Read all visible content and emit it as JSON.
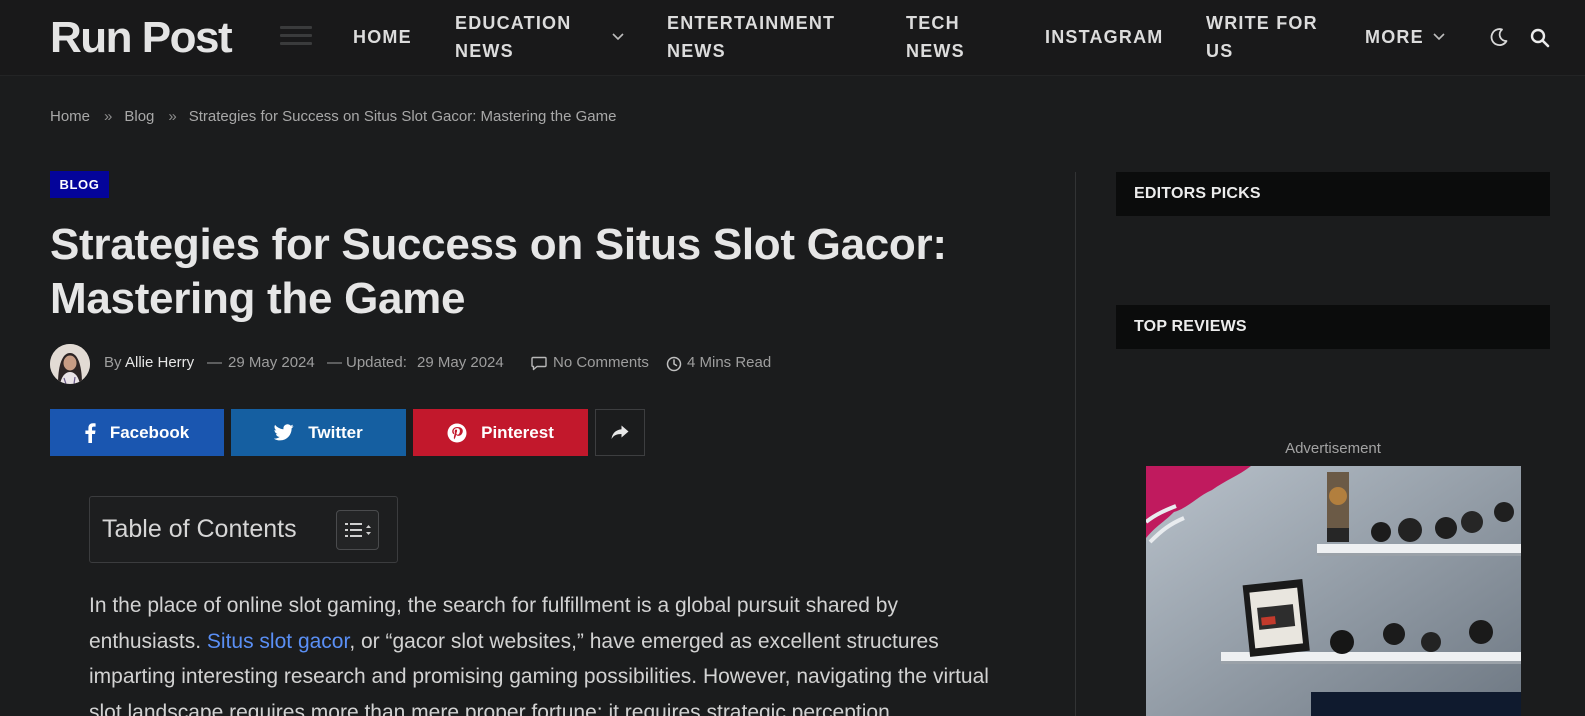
{
  "header": {
    "logo": "Run Post",
    "nav": [
      {
        "label": "HOME"
      },
      {
        "label_line1": "EDUCATION",
        "label_line2": "NEWS"
      },
      {
        "label_line1": "ENTERTAINMENT",
        "label_line2": "NEWS"
      },
      {
        "label_line1": "TECH",
        "label_line2": "NEWS"
      },
      {
        "label": "INSTAGRAM"
      },
      {
        "label_line1": "WRITE FOR",
        "label_line2": "US"
      },
      {
        "label": "MORE"
      }
    ],
    "icons": [
      "menu-icon",
      "chevron-down-icon",
      "moon-icon",
      "search-icon"
    ]
  },
  "breadcrumb": {
    "items": [
      "Home",
      "Blog",
      "Strategies for Success on Situs Slot Gacor: Mastering the Game"
    ],
    "separator": "»"
  },
  "article": {
    "category": "BLOG",
    "title_line1": "Strategies for Success on Situs Slot Gacor:",
    "title_line2": "Mastering the Game",
    "meta": {
      "by": "By",
      "author": "Allie Herry",
      "dash": "—",
      "published": "29 May 2024",
      "updated_label": "Updated:",
      "updated": "29 May 2024",
      "comments": "No Comments",
      "read_time": "4 Mins Read"
    },
    "share": {
      "facebook": "Facebook",
      "twitter": "Twitter",
      "pinterest": "Pinterest"
    },
    "toc_title": "Table of Contents",
    "body": {
      "p1_a": "In the place of online slot gaming, the search for fulfillment is a global pursuit shared by enthusiasts. ",
      "p1_link": "Situs slot gacor",
      "p1_b": ", or “gacor slot websites,” have emerged as excellent structures imparting interesting research and promising gaming possibilities. However, navigating the virtual slot landscape requires more than mere proper fortune; it requires strategic perception"
    }
  },
  "sidebar": {
    "editors_picks": "EDITORS PICKS",
    "top_reviews": "TOP REVIEWS",
    "ad_label": "Advertisement"
  },
  "colors": {
    "background": "#1b1c1d",
    "category_badge": "#04049a",
    "facebook": "#1a56b0",
    "twitter": "#155fa1",
    "pinterest": "#c2182c",
    "link": "#5a8ff5"
  }
}
